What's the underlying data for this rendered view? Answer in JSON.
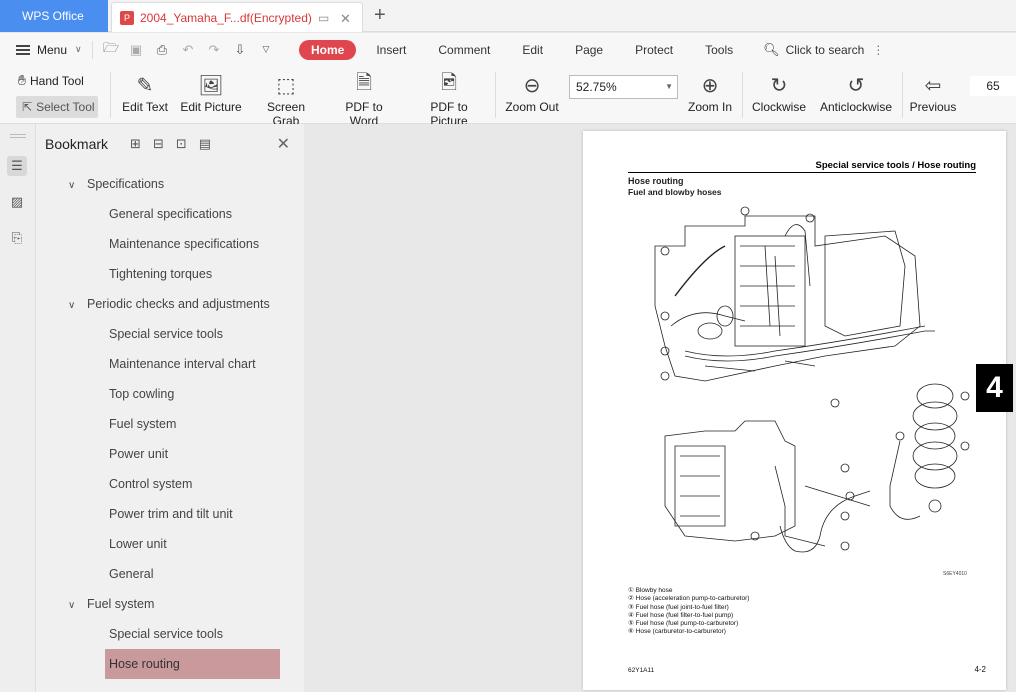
{
  "titlebar": {
    "app_name": "WPS Office",
    "doc_tab_title": "2004_Yamaha_F...df(Encrypted)"
  },
  "menubar": {
    "menu_label": "Menu",
    "tabs": [
      "Home",
      "Insert",
      "Comment",
      "Edit",
      "Page",
      "Protect",
      "Tools"
    ],
    "search_label": "Click to search"
  },
  "toolbar": {
    "hand_tool": "Hand Tool",
    "select_tool": "Select Tool",
    "edit_text": "Edit Text",
    "edit_picture": "Edit Picture",
    "screen_grab": "Screen Grab",
    "pdf_to_word": "PDF to Word",
    "pdf_to_picture": "PDF to Picture",
    "zoom_out": "Zoom Out",
    "zoom_value": "52.75%",
    "zoom_in": "Zoom In",
    "clockwise": "Clockwise",
    "anticlockwise": "Anticlockwise",
    "previous": "Previous",
    "page_number": "65"
  },
  "bookmark_panel": {
    "title": "Bookmark",
    "items": [
      {
        "label": "Specifications",
        "level": 1
      },
      {
        "label": "General specifications",
        "level": 2
      },
      {
        "label": "Maintenance specifications",
        "level": 2
      },
      {
        "label": "Tightening torques",
        "level": 2
      },
      {
        "label": "Periodic checks and adjustments",
        "level": 1
      },
      {
        "label": "Special service tools",
        "level": 2
      },
      {
        "label": "Maintenance interval chart",
        "level": 2
      },
      {
        "label": "Top cowling",
        "level": 2
      },
      {
        "label": "Fuel system",
        "level": 2
      },
      {
        "label": "Power unit",
        "level": 2
      },
      {
        "label": "Control system",
        "level": 2
      },
      {
        "label": "Power trim and tilt unit",
        "level": 2
      },
      {
        "label": "Lower unit",
        "level": 2
      },
      {
        "label": "General",
        "level": 2
      },
      {
        "label": "Fuel system",
        "level": 1
      },
      {
        "label": "Special service tools",
        "level": 2
      },
      {
        "label": "Hose routing",
        "level": 2,
        "selected": true
      }
    ]
  },
  "page": {
    "header": "Special service tools / Hose routing",
    "heading": "Hose routing",
    "subheading": "Fuel and blowby hoses",
    "chapter_tab": "4",
    "figure_code": "S6EY4010",
    "legend": [
      "① Blowby hose",
      "② Hose (acceleration pump-to-carburetor)",
      "③ Fuel hose (fuel joint-to-fuel filter)",
      "④ Fuel hose (fuel filter-to-fuel pump)",
      "⑤ Fuel hose (fuel pump-to-carburetor)",
      "⑥ Hose (carburetor-to-carburetor)"
    ],
    "footer_left": "62Y1A11",
    "footer_right": "4-2"
  }
}
